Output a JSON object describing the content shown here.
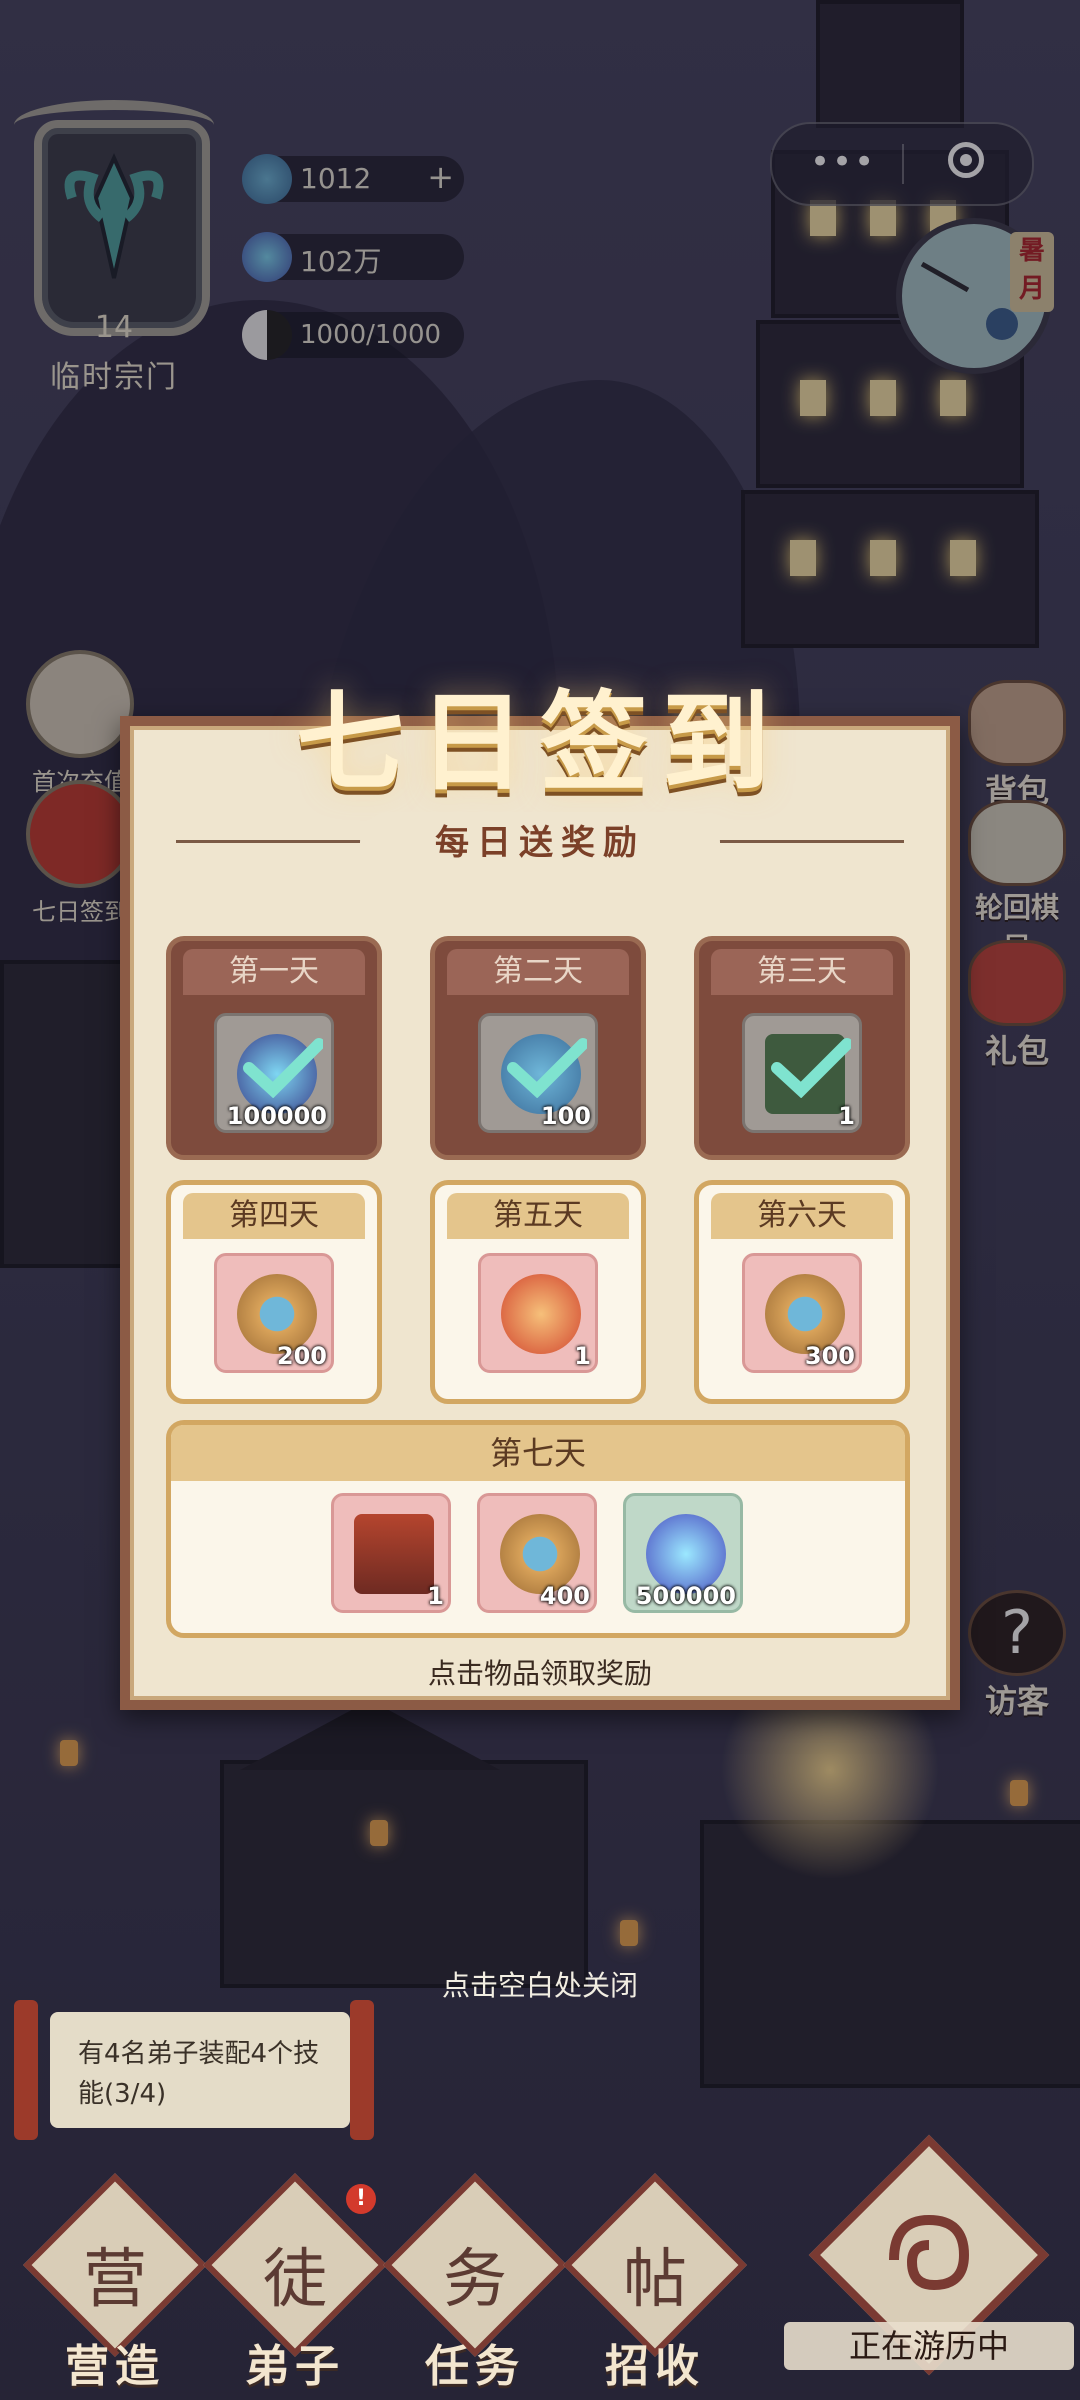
{
  "hud": {
    "sect_level": "14",
    "sect_name": "临时宗门",
    "resources": [
      {
        "name": "spirit-cloud",
        "value": "1012",
        "has_plus": true
      },
      {
        "name": "spirit-crystal",
        "value": "102万",
        "has_plus": false
      },
      {
        "name": "stamina",
        "value": "1000/1000",
        "has_plus": false
      }
    ],
    "season": "暑月"
  },
  "side_left": [
    {
      "label": "首次充值"
    },
    {
      "label": "七日签到"
    }
  ],
  "side_right": [
    {
      "label": "背包"
    },
    {
      "label": "轮回棋局"
    },
    {
      "label": "礼包"
    },
    {
      "label": "访客"
    }
  ],
  "modal": {
    "title": "七日签到",
    "subtitle": "每日送奖励",
    "days": [
      {
        "label": "第一天",
        "state": "claimed",
        "item": {
          "icon": "crystal-icon",
          "qty": "100000",
          "bg": "dark"
        }
      },
      {
        "label": "第二天",
        "state": "claimed",
        "item": {
          "icon": "cloud-icon",
          "qty": "100",
          "bg": "dark"
        }
      },
      {
        "label": "第三天",
        "state": "claimed",
        "item": {
          "icon": "book-icon",
          "qty": "1",
          "bg": "dark"
        }
      },
      {
        "label": "第四天",
        "state": "pending",
        "item": {
          "icon": "cloud-icon",
          "qty": "200",
          "bg": "pink"
        }
      },
      {
        "label": "第五天",
        "state": "pending",
        "item": {
          "icon": "charm-icon",
          "qty": "1",
          "bg": "pink"
        }
      },
      {
        "label": "第六天",
        "state": "pending",
        "item": {
          "icon": "cloud-icon",
          "qty": "300",
          "bg": "pink"
        }
      }
    ],
    "day7": {
      "label": "第七天",
      "items": [
        {
          "icon": "book-icon",
          "qty": "1",
          "bg": "pink"
        },
        {
          "icon": "cloud-icon",
          "qty": "400",
          "bg": "pink"
        },
        {
          "icon": "crystal-icon",
          "qty": "500000",
          "bg": "green"
        }
      ]
    },
    "hint": "点击物品领取奖励"
  },
  "close_hint": "点击空白处关闭",
  "task": {
    "text": "有4名弟子装配4个技能(3/4)"
  },
  "nav": [
    {
      "label": "营造",
      "glyph": "营",
      "badge": ""
    },
    {
      "label": "弟子",
      "glyph": "徒",
      "badge": "!"
    },
    {
      "label": "任务",
      "glyph": "务",
      "badge": ""
    },
    {
      "label": "招收",
      "glyph": "帖",
      "badge": ""
    }
  ],
  "travel": {
    "status": "正在游历中"
  },
  "colors": {
    "accent": "#8c5b45",
    "title": "#fff1cf",
    "claimed": "#7e4b3d",
    "pending_border": "#d2a762"
  }
}
